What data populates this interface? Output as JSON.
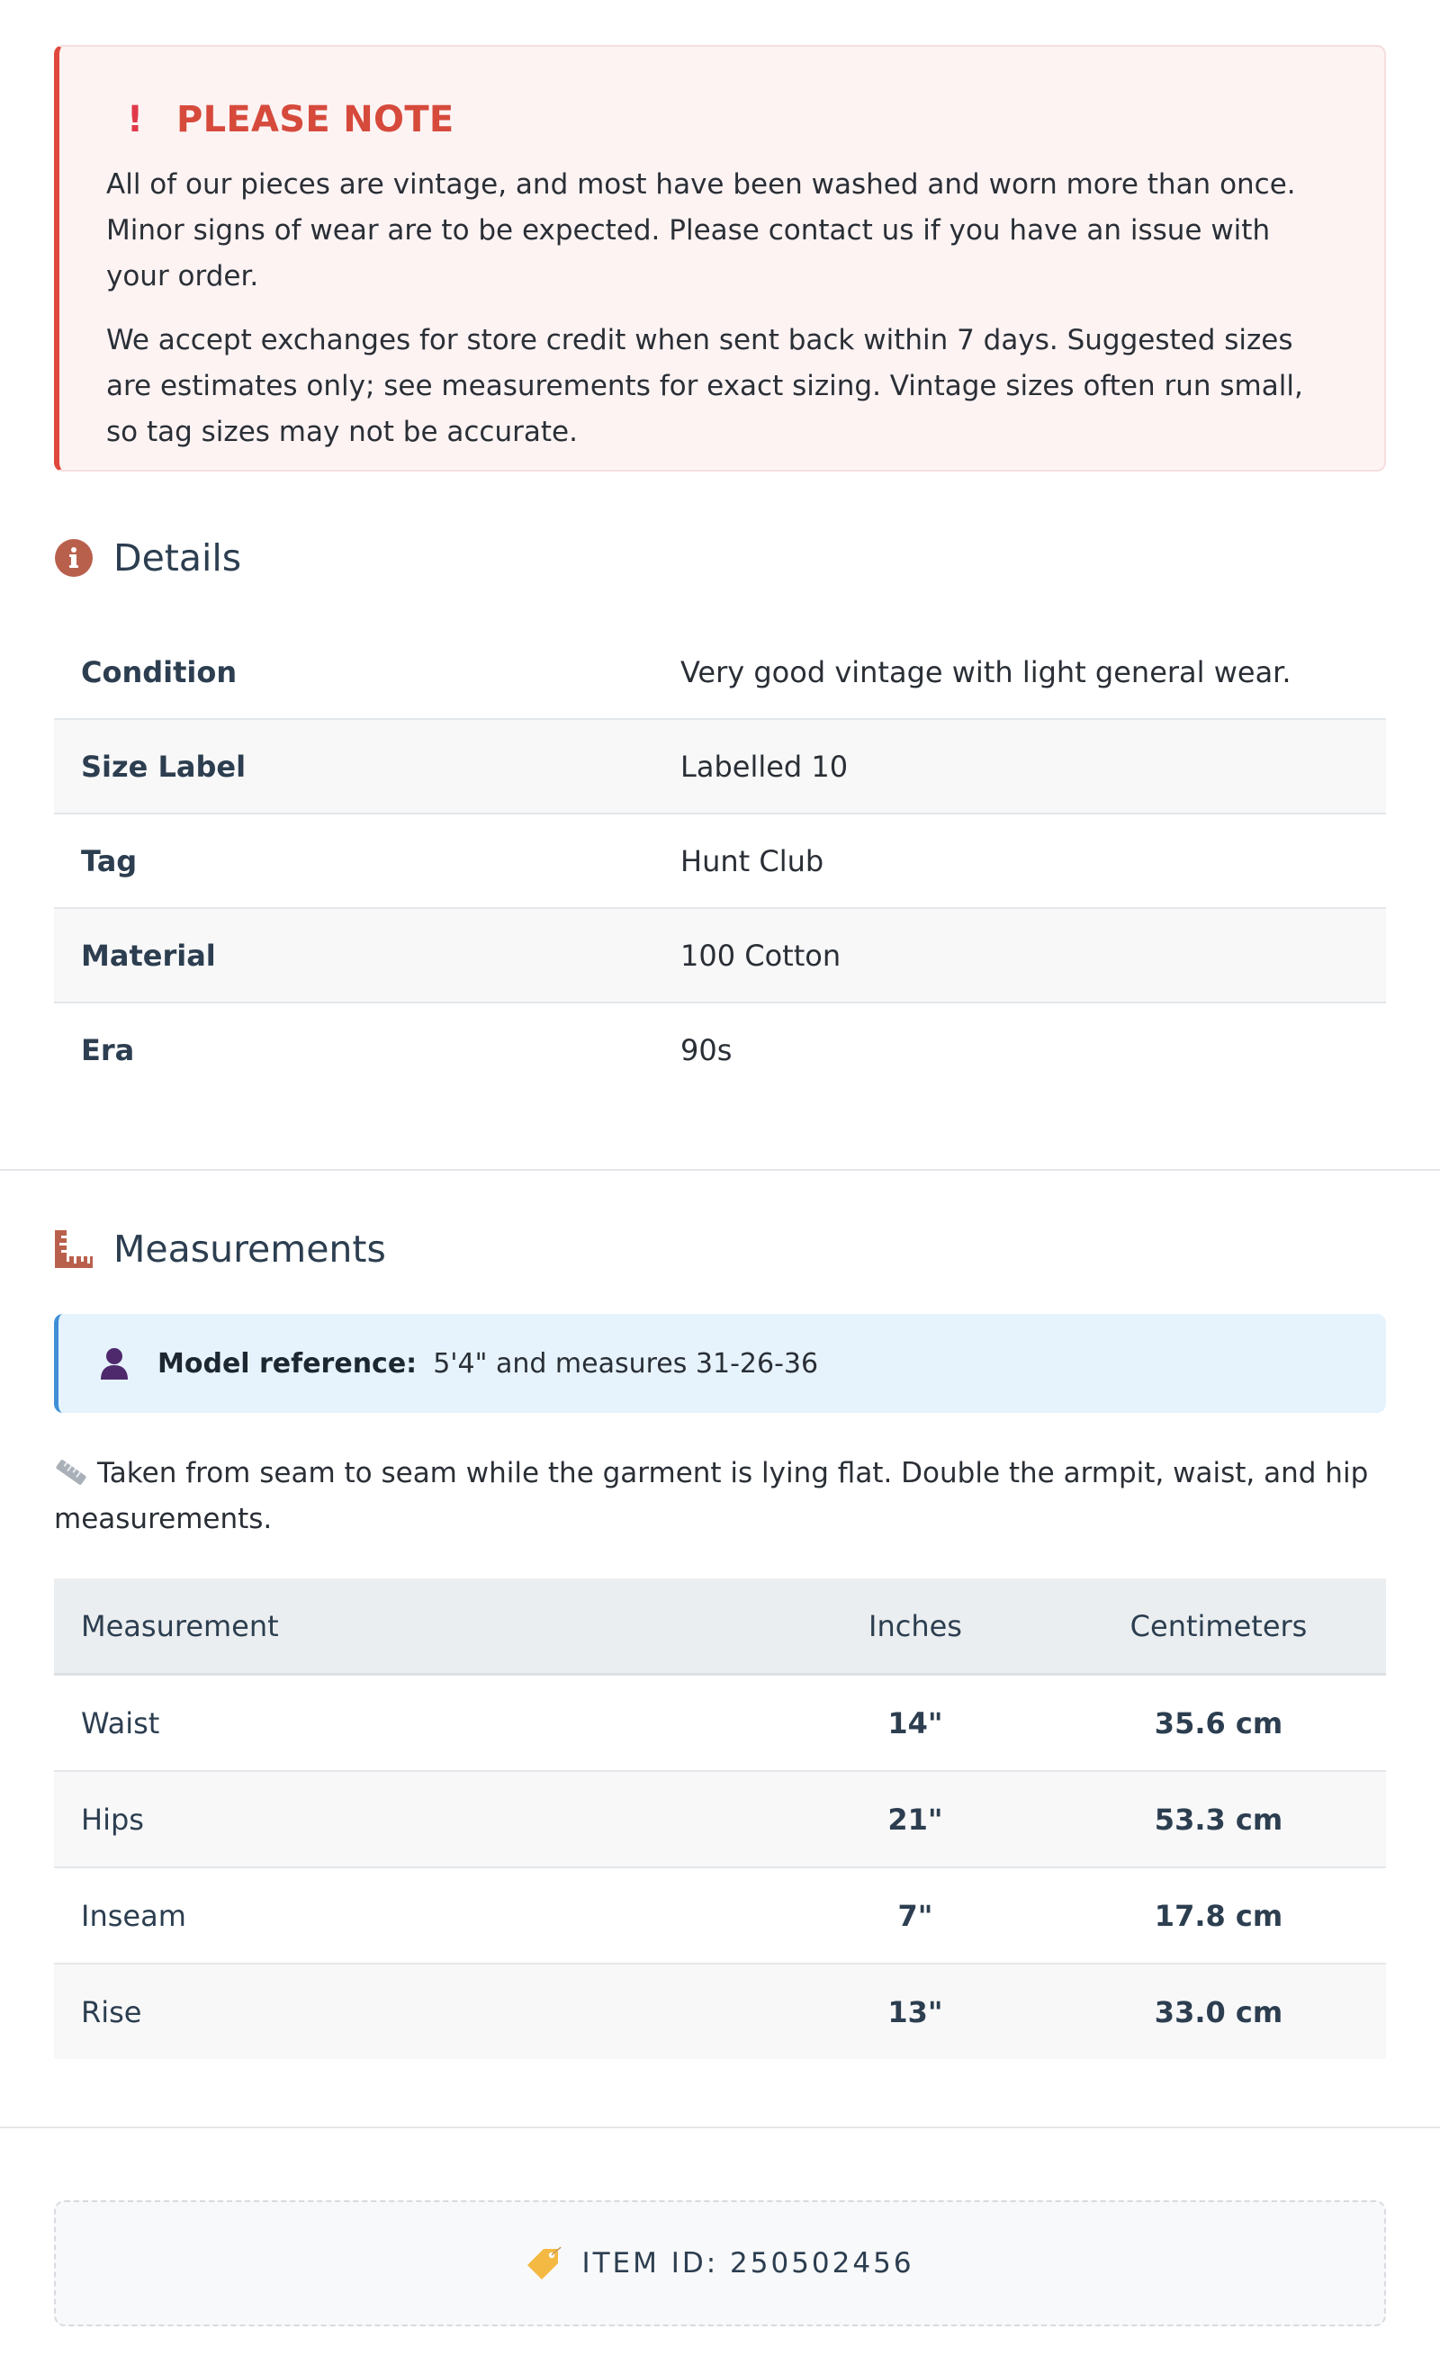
{
  "notice": {
    "title": "PLEASE NOTE",
    "paragraph_1": "All of our pieces are vintage, and most have been washed and worn more than once. Minor signs of wear are to be expected. Please contact us if you have an issue with your order.",
    "paragraph_2": "We accept exchanges for store credit when sent back within 7 days. Suggested sizes are estimates only; see measurements for exact sizing. Vintage sizes often run small, so tag sizes may not be accurate.",
    "icon": "exclamation-icon"
  },
  "details": {
    "title": "Details",
    "icon": "info-circle-icon",
    "rows": [
      {
        "key": "Condition",
        "value": "Very good vintage with light general wear."
      },
      {
        "key": "Size Label",
        "value": "Labelled 10"
      },
      {
        "key": "Tag",
        "value": "Hunt Club"
      },
      {
        "key": "Material",
        "value": "100 Cotton"
      },
      {
        "key": "Era",
        "value": "90s"
      }
    ]
  },
  "measurements": {
    "title": "Measurements",
    "icon": "ruler-combined-icon",
    "model_reference": {
      "label": "Model reference:",
      "value": "5'4\" and measures 31-26-36",
      "icon": "person-icon"
    },
    "note": "Taken from seam to seam while the garment is lying flat. Double the armpit, waist, and hip measurements.",
    "table": {
      "headers": [
        "Measurement",
        "Inches",
        "Centimeters"
      ],
      "rows": [
        {
          "name": "Waist",
          "inches": "14\"",
          "cm": "35.6 cm"
        },
        {
          "name": "Hips",
          "inches": "21\"",
          "cm": "53.3 cm"
        },
        {
          "name": "Inseam",
          "inches": "7\"",
          "cm": "17.8 cm"
        },
        {
          "name": "Rise",
          "inches": "13\"",
          "cm": "33.0 cm"
        }
      ]
    }
  },
  "item_id": {
    "text": "ITEM ID: 250502456",
    "icon": "price-tag-icon"
  },
  "colors": {
    "notice_accent": "#e0483e",
    "notice_bg": "#fdf3f3",
    "icon_brown": "#b9604d",
    "info_accent": "#3f8fd6",
    "info_bg": "#e6f3fd",
    "text": "#2c3e50"
  }
}
